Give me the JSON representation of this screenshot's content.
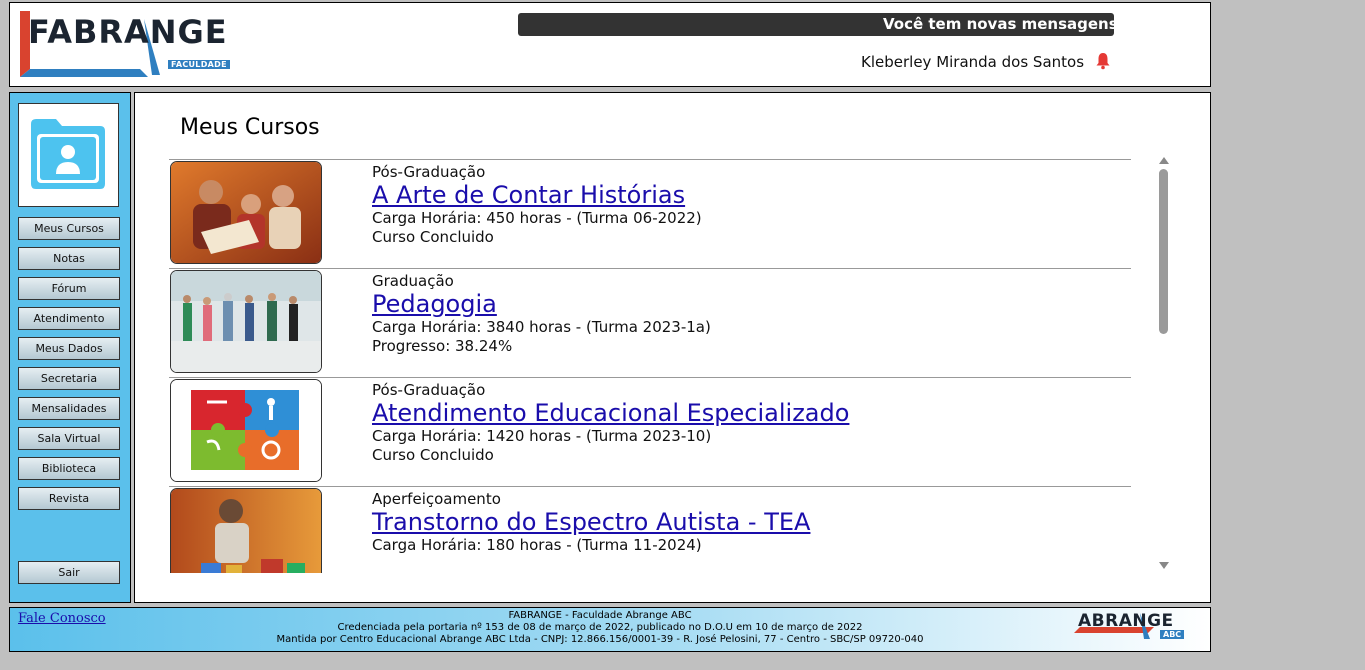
{
  "header": {
    "logo_text": "FABRANGE",
    "logo_sub": "FACULDADE",
    "marquee": "Você tem novas mensagens",
    "user_name": "Kleberley Miranda dos Santos",
    "accent": "#e53935"
  },
  "sidebar": {
    "avatar_icon": "user-folder-icon",
    "items": [
      {
        "label": "Meus Cursos"
      },
      {
        "label": "Notas"
      },
      {
        "label": "Fórum"
      },
      {
        "label": "Atendimento"
      },
      {
        "label": "Meus Dados"
      },
      {
        "label": "Secretaria"
      },
      {
        "label": "Mensalidades"
      },
      {
        "label": "Sala Virtual"
      },
      {
        "label": "Biblioteca"
      },
      {
        "label": "Revista"
      }
    ],
    "logout": "Sair",
    "bg_color": "#5bc0eb"
  },
  "main": {
    "title": "Meus Cursos",
    "courses": [
      {
        "level": "Pós-Graduação",
        "title": "A Arte de Contar Histórias",
        "hours": "Carga Horária: 450 horas - (Turma 06-2022)",
        "status": "Curso Concluido"
      },
      {
        "level": "Graduação",
        "title": "Pedagogia",
        "hours": "Carga Horária: 3840 horas - (Turma 2023-1a)",
        "status": "Progresso: 38.24%"
      },
      {
        "level": "Pós-Graduação",
        "title": "Atendimento Educacional Especializado",
        "hours": "Carga Horária: 1420 horas - (Turma 2023-10)",
        "status": "Curso Concluido"
      },
      {
        "level": "Aperfeiçoamento",
        "title": "Transtorno do Espectro Autista - TEA",
        "hours": "Carga Horária: 180 horas - (Turma 11-2024)",
        "status": ""
      }
    ]
  },
  "footer": {
    "contact_link": "Fale Conosco",
    "line1": "FABRANGE - Faculdade Abrange ABC",
    "line2": "Credenciada pela portaria nº 153 de 08 de março de 2022, publicado no D.O.U em 10 de março de 2022",
    "line3": "Mantida por Centro Educacional Abrange ABC Ltda - CNPJ: 12.866.156/0001-39 - R. José Pelosini, 77 - Centro - SBC/SP 09720-040",
    "logo_text": "ABRANGE",
    "logo_sub": "ABC"
  }
}
